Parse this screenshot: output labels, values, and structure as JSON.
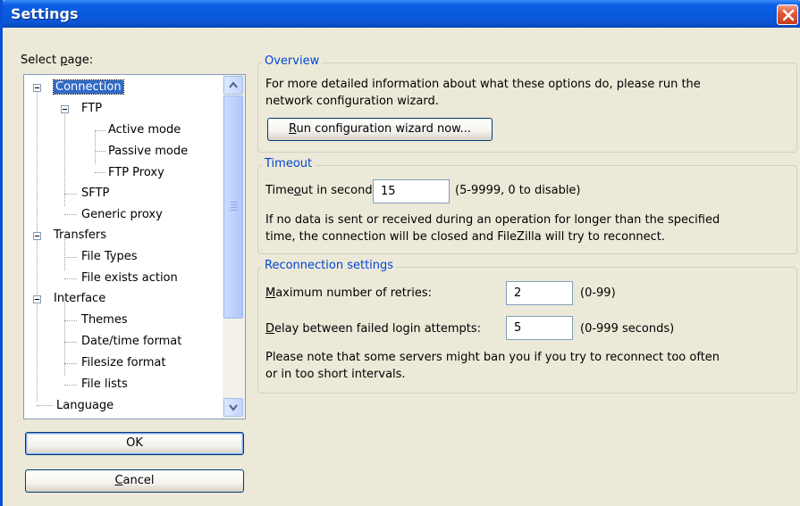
{
  "window": {
    "title": "Settings"
  },
  "select_page_label_pre": "Select ",
  "select_page_label_u": "p",
  "select_page_label_post": "age:",
  "tree": [
    {
      "label": "Connection"
    },
    {
      "label": "FTP"
    },
    {
      "label": "Active mode"
    },
    {
      "label": "Passive mode"
    },
    {
      "label": "FTP Proxy"
    },
    {
      "label": "SFTP"
    },
    {
      "label": "Generic proxy"
    },
    {
      "label": "Transfers"
    },
    {
      "label": "File Types"
    },
    {
      "label": "File exists action"
    },
    {
      "label": "Interface"
    },
    {
      "label": "Themes"
    },
    {
      "label": "Date/time format"
    },
    {
      "label": "Filesize format"
    },
    {
      "label": "File lists"
    },
    {
      "label": "Language"
    }
  ],
  "buttons": {
    "ok": "OK",
    "cancel_u": "C",
    "cancel_rest": "ancel"
  },
  "overview": {
    "title": "Overview",
    "line1": "For more detailed information about what these options do, please run the",
    "line2": "network configuration wizard.",
    "wizard_u": "R",
    "wizard_rest": "un configuration wizard now..."
  },
  "timeout": {
    "title": "Timeout",
    "label_pre": "Time",
    "label_u": "o",
    "label_post": "ut in seconds:",
    "value": "15",
    "hint": "(5-9999, 0 to disable)",
    "desc1": "If no data is sent or received during an operation for longer than the specified",
    "desc2": "time, the connection will be closed and FileZilla will try to reconnect."
  },
  "reconnect": {
    "title": "Reconnection settings",
    "retries_u": "M",
    "retries_rest": "aximum number of retries:",
    "retries_value": "2",
    "retries_hint": "(0-99)",
    "delay_u": "D",
    "delay_rest": "elay between failed login attempts:",
    "delay_value": "5",
    "delay_hint": "(0-999 seconds)",
    "note1": "Please note that some servers might ban you if you try to reconnect too often",
    "note2": "or in too short intervals."
  }
}
